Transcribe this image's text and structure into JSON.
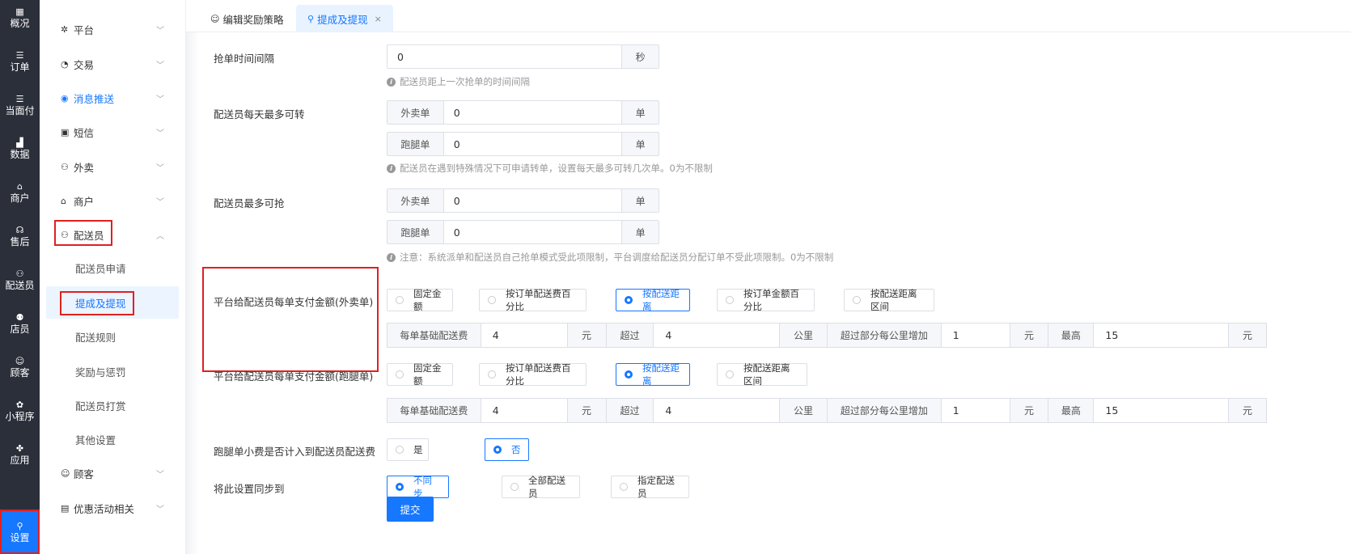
{
  "rail": [
    {
      "icon": "dashboard-icon",
      "glyph": "▦",
      "label": "概况"
    },
    {
      "icon": "list-icon",
      "glyph": "☰",
      "label": "订单"
    },
    {
      "icon": "list-icon",
      "glyph": "☰",
      "label": "当面付"
    },
    {
      "icon": "bar-chart-icon",
      "glyph": "▟",
      "label": "数据"
    },
    {
      "icon": "shop-icon",
      "glyph": "⌂",
      "label": "商户"
    },
    {
      "icon": "headset-icon",
      "glyph": "☊",
      "label": "售后"
    },
    {
      "icon": "scooter-icon",
      "glyph": "⚇",
      "label": "配送员"
    },
    {
      "icon": "users-icon",
      "glyph": "⚉",
      "label": "店员"
    },
    {
      "icon": "customer-icon",
      "glyph": "☺",
      "label": "顾客"
    },
    {
      "icon": "wechat-icon",
      "glyph": "✿",
      "label": "小程序"
    },
    {
      "icon": "apps-icon",
      "glyph": "✤",
      "label": "应用"
    },
    {
      "icon": "settings-user-icon",
      "glyph": "⚲",
      "label": "设置"
    }
  ],
  "submenu": {
    "groups": [
      {
        "glyph": "✲",
        "label": "平台"
      },
      {
        "glyph": "◔",
        "label": "交易"
      },
      {
        "glyph": "◉",
        "label": "消息推送"
      },
      {
        "glyph": "▣",
        "label": "短信"
      },
      {
        "glyph": "⚇",
        "label": "外卖"
      },
      {
        "glyph": "⌂",
        "label": "商户"
      },
      {
        "glyph": "⚇",
        "label": "配送员"
      }
    ],
    "subitems": [
      "配送员申请",
      "提成及提现",
      "配送规则",
      "奖励与惩罚",
      "配送员打赏",
      "其他设置"
    ],
    "groups_after": [
      {
        "glyph": "☺",
        "label": "顾客"
      },
      {
        "glyph": "▤",
        "label": "优惠活动相关"
      }
    ]
  },
  "tabs": [
    {
      "label": "编辑奖励策略",
      "glyph": "☺"
    },
    {
      "label": "提成及提现",
      "glyph": "⚲",
      "close": "×"
    }
  ],
  "form": {
    "grab_interval": {
      "label": "抢单时间间隔",
      "value": "0",
      "unit": "秒",
      "hint": "配送员距上一次抢单的时间间隔"
    },
    "max_transfer": {
      "label": "配送员每天最多可转",
      "rows": [
        {
          "prefix": "外卖单",
          "value": "0",
          "unit": "单"
        },
        {
          "prefix": "跑腿单",
          "value": "0",
          "unit": "单"
        }
      ],
      "hint": "配送员在遇到特殊情况下可申请转单，设置每天最多可转几次单。0为不限制"
    },
    "max_grab": {
      "label": "配送员最多可抢",
      "rows": [
        {
          "prefix": "外卖单",
          "value": "0",
          "unit": "单"
        },
        {
          "prefix": "跑腿单",
          "value": "0",
          "unit": "单"
        }
      ],
      "hint": "注意：系统派单和配送员自己抢单模式受此项限制，平台调度给配送员分配订单不受此项限制。0为不限制"
    },
    "pay_takeout": {
      "label": "平台给配送员每单支付金额(外卖单)",
      "options": [
        "固定金额",
        "按订单配送费百分比",
        "按配送距离",
        "按订单金额百分比",
        "按配送距离区间"
      ],
      "selected": 2
    },
    "pay_takeout_detail": {
      "base_label": "每单基础配送费",
      "base": "4",
      "yuan": "元",
      "over_label": "超过",
      "over": "4",
      "km": "公里",
      "extra_label": "超过部分每公里增加",
      "extra": "1",
      "max_label": "最高",
      "max": "15"
    },
    "pay_errand": {
      "label": "平台给配送员每单支付金额(跑腿单)",
      "options": [
        "固定金额",
        "按订单配送费百分比",
        "按配送距离",
        "按配送距离区间"
      ],
      "selected": 2
    },
    "pay_errand_detail": {
      "base_label": "每单基础配送费",
      "base": "4",
      "yuan": "元",
      "over_label": "超过",
      "over": "4",
      "km": "公里",
      "extra_label": "超过部分每公里增加",
      "extra": "1",
      "max_label": "最高",
      "max": "15"
    },
    "tip_included": {
      "label": "跑腿单小费是否计入到配送员配送费",
      "options": [
        "是",
        "否"
      ],
      "selected": 1
    },
    "sync": {
      "label": "将此设置同步到",
      "options": [
        "不同步",
        "全部配送员",
        "指定配送员"
      ],
      "selected": 0
    },
    "submit": "提交"
  }
}
